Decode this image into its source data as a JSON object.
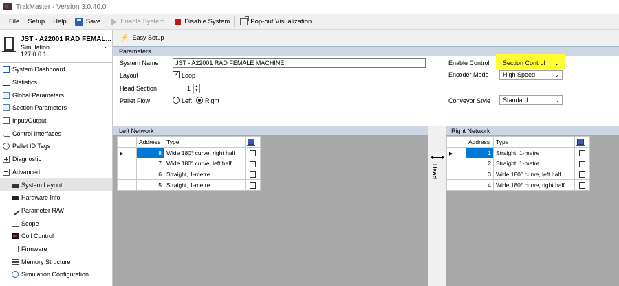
{
  "window": {
    "title": "TrakMaster - Version 3.0.40.0"
  },
  "menu": {
    "items": [
      "File",
      "Setup",
      "Help"
    ]
  },
  "toolbar": {
    "save": "Save",
    "enable_system": "Enable System",
    "disable_system": "Disable System",
    "popout": "Pop-out Visualization"
  },
  "system": {
    "name": "JST - A22001 RAD FEMAL...",
    "mode": "Simulation",
    "ip": "127.0.0.1"
  },
  "sidebar": {
    "items": [
      {
        "label": "System Dashboard"
      },
      {
        "label": "Statistics"
      },
      {
        "label": "Global Parameters"
      },
      {
        "label": "Section Parameters"
      },
      {
        "label": "Input/Output"
      },
      {
        "label": "Control Interfaces"
      },
      {
        "label": "Pallet ID Tags"
      },
      {
        "label": "Diagnostic"
      },
      {
        "label": "Advanced"
      },
      {
        "label": "System Layout"
      },
      {
        "label": "Hardware Info"
      },
      {
        "label": "Parameter R/W"
      },
      {
        "label": "Scope"
      },
      {
        "label": "Coil Control"
      },
      {
        "label": "Firmware"
      },
      {
        "label": "Memory Structure"
      },
      {
        "label": "Simulation Configuration"
      }
    ]
  },
  "easy_setup": {
    "title": "Easy Setup"
  },
  "parameters": {
    "header": "Parameters",
    "system_name_label": "System Name",
    "system_name_value": "JST - A22001 RAD FEMALE MACHINE",
    "layout_label": "Layout",
    "loop_label": "Loop",
    "head_section_label": "Head Section",
    "head_section_value": "1",
    "pallet_flow_label": "Pallet Flow",
    "left_label": "Left",
    "right_label": "Right",
    "enable_control_label": "Enable Control",
    "enable_control_value": "Section Control",
    "encoder_mode_label": "Encoder Mode",
    "encoder_mode_value": "High Speed",
    "conveyor_style_label": "Conveyor Style",
    "conveyor_style_value": "Standard"
  },
  "left_network": {
    "header": "Left Network",
    "columns": {
      "address": "Address",
      "type": "Type"
    },
    "rows": [
      {
        "address": "8",
        "type": "Wide 180° curve, right half"
      },
      {
        "address": "7",
        "type": "Wide 180° curve, left half"
      },
      {
        "address": "6",
        "type": "Straight, 1-metre"
      },
      {
        "address": "5",
        "type": "Straight, 1-metre"
      }
    ]
  },
  "right_network": {
    "header": "Right Network",
    "columns": {
      "address": "Address",
      "type": "Type"
    },
    "rows": [
      {
        "address": "1",
        "type": "Straight, 1-metre"
      },
      {
        "address": "2",
        "type": "Straight, 1-metre"
      },
      {
        "address": "3",
        "type": "Wide 180° curve, left half"
      },
      {
        "address": "4",
        "type": "Wide 180° curve, right half"
      }
    ]
  },
  "head": {
    "label": "Head"
  },
  "colors": {
    "highlight": "#ffff33",
    "selection": "#0078d7",
    "section_header": "#ccd5e2"
  }
}
